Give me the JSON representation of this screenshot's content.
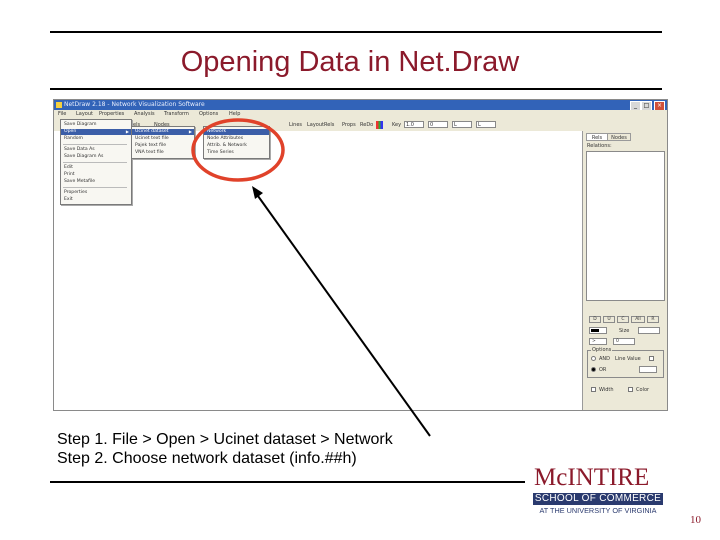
{
  "slide": {
    "title": "Opening Data in Net.Draw",
    "steps": [
      "Step 1. File > Open > Ucinet dataset > Network",
      "Step 2. Choose network dataset (info.##h)"
    ],
    "page_number": "10"
  },
  "logo": {
    "name": "McINTIRE",
    "school": "SCHOOL OF COMMERCE",
    "university": "AT THE UNIVERSITY OF VIRGINIA"
  },
  "app": {
    "title": "NetDraw 2.18 - Network Visualization Software",
    "window_buttons": [
      "_",
      "□",
      "×"
    ],
    "menu": [
      "File",
      "Layout",
      "Properties",
      "Analysis",
      "Transform",
      "Options",
      "Help"
    ],
    "toolbar": {
      "items": [
        "Labels",
        "Nodes",
        "Lines",
        "Layout",
        "Rels",
        "Props",
        "ReDo"
      ],
      "key_label": "Key",
      "key_value": "1.0",
      "value_box": "0",
      "field_a": "L",
      "field_b": "L"
    },
    "file_menu": {
      "items": [
        "Save Diagram",
        "Open",
        "Random",
        "Save Data As",
        "Save Diagram As",
        "Edit",
        "Print",
        "Save Metafile",
        "Properties",
        "Exit"
      ],
      "highlighted": "Open"
    },
    "open_submenu": {
      "items": [
        "Ucinet dataset",
        "Ucinet text file",
        "Pajek text file",
        "VNA text file"
      ],
      "highlighted": "Ucinet dataset"
    },
    "ucinet_submenu": {
      "items": [
        "Network",
        "Node Attributes",
        "Attrib. & Network",
        "Time Series"
      ],
      "highlighted": "Network"
    },
    "panel": {
      "tabs": [
        "Rels",
        "Nodes"
      ],
      "relations_label": "Relations:",
      "style_buttons": [
        "D",
        "U",
        "C",
        "All",
        "R"
      ],
      "size_label": "Size",
      "options_label": "Options",
      "and_label": "AND",
      "lines_label": "Line Value",
      "or_label": "OR",
      "width_label": "Width",
      "color_label": "Color",
      "threshold_symbol": ">",
      "threshold_value": "0"
    }
  }
}
